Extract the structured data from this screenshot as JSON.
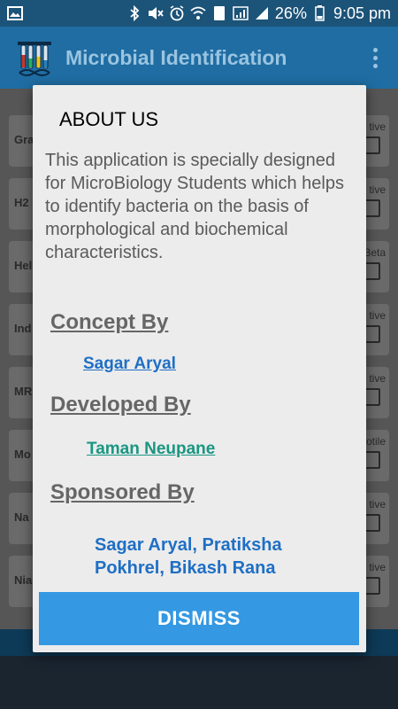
{
  "status_bar": {
    "battery": "26%",
    "time": "9:05 pm",
    "sim_label": "1"
  },
  "app_bar": {
    "title": "Microbial Identification"
  },
  "background_rows": [
    {
      "label": "Gra",
      "option": "tive"
    },
    {
      "label": "H2",
      "option": "tive"
    },
    {
      "label": "Hel",
      "option": "Beta"
    },
    {
      "label": "Ind",
      "option": "tive"
    },
    {
      "label": "MR",
      "option": "tive"
    },
    {
      "label": "Mo",
      "option": "otile"
    },
    {
      "label": "Na",
      "option": "tive"
    },
    {
      "label": "Nia",
      "option": "tive"
    }
  ],
  "dialog": {
    "title": "ABOUT US",
    "description": "This application is specially designed for MicroBiology Students which helps to identify bacteria on the basis of morphological and biochemical characteristics.",
    "concept_heading": "Concept By",
    "concept_name": "Sagar Aryal",
    "developed_heading": "Developed By",
    "developed_name": "Taman Neupane",
    "sponsored_heading": "Sponsored By",
    "sponsored_names": "Sagar Aryal, Pratiksha Pokhrel, Bikash Rana",
    "dismiss_label": "DISMISS"
  },
  "colors": {
    "status_bar": "#1c5378",
    "app_bar": "#1f6da3",
    "dialog_bg": "#ececec",
    "dismiss_button": "#3498e2",
    "link_blue": "#1f6fc4",
    "link_teal": "#1a9682"
  },
  "icons": {
    "status_left": "gallery-icon",
    "status_right": [
      "bluetooth-icon",
      "mute-icon",
      "alarm-icon",
      "wifi-icon",
      "sim-icon",
      "signal-icon",
      "signal-icon",
      "battery-icon"
    ],
    "app_logo": "dna-tubes-logo-icon",
    "overflow": "overflow-menu-icon"
  }
}
